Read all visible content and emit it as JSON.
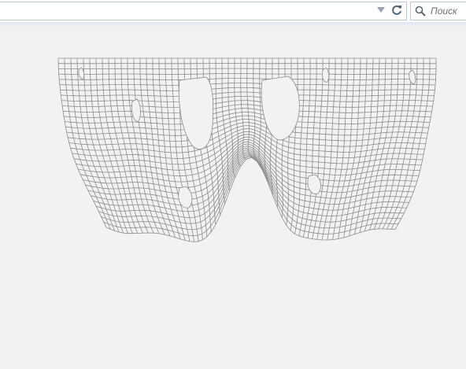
{
  "toolbar": {
    "url_value": "",
    "search_placeholder": "Поиск"
  },
  "icons": {
    "dropdown": "chevron-down-icon",
    "reload": "reload-icon",
    "search": "search-icon"
  },
  "colors": {
    "page_background": "#f2f2f2",
    "mesh_line": "#8c8c8c"
  }
}
